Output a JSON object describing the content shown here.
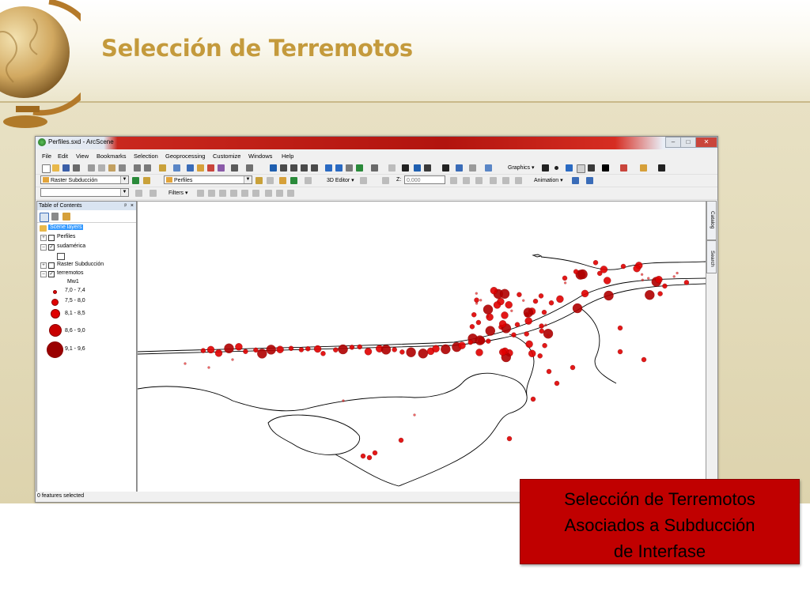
{
  "slide": {
    "title": "Selección de Terremotos"
  },
  "window": {
    "title": "Perfiles.sxd - ArcScene",
    "minimize": "–",
    "maximize": "□",
    "close": "✕"
  },
  "menu": [
    "File",
    "Edit",
    "View",
    "Bookmarks",
    "Selection",
    "Geoprocessing",
    "Customize",
    "Windows",
    "Help"
  ],
  "toolbar1": {
    "graphics_label": "Graphics ▾"
  },
  "toolbar2": {
    "layer_combo": "Raster Subducción",
    "target_combo": "Perfiles",
    "editor_label": "3D Editor ▾",
    "z_label": "Z:",
    "z_value": "0,000",
    "animation_label": "Animation ▾"
  },
  "toolbar3": {
    "filters_label": "Filters ▾"
  },
  "toc": {
    "header": "Table of Contents",
    "pin": "ᵖ",
    "close": "×",
    "root": "Scene layers",
    "layers": [
      {
        "name": "Perfiles",
        "checked": false
      },
      {
        "name": "sudamérica",
        "checked": true
      },
      {
        "name": "Raster Subducción",
        "checked": false
      },
      {
        "name": "terremotos",
        "checked": true
      }
    ],
    "legend_field": "Mw1",
    "legend": [
      "7,0 - 7,4",
      "7,5 - 8,0",
      "8,1 - 8,5",
      "8,6 - 9,0",
      "9,1 - 9,6"
    ]
  },
  "side_tabs": [
    "Catalog",
    "Search"
  ],
  "status": "0 features selected",
  "callout": {
    "line1": "Selección de Terremotos",
    "line2": "Asociados a Subducción",
    "line3": "de Interfase"
  },
  "colors": {
    "quake": "#e00000",
    "quake_stroke": "#8a0000",
    "callout_bg": "#c00000",
    "title": "#c49a3c"
  }
}
